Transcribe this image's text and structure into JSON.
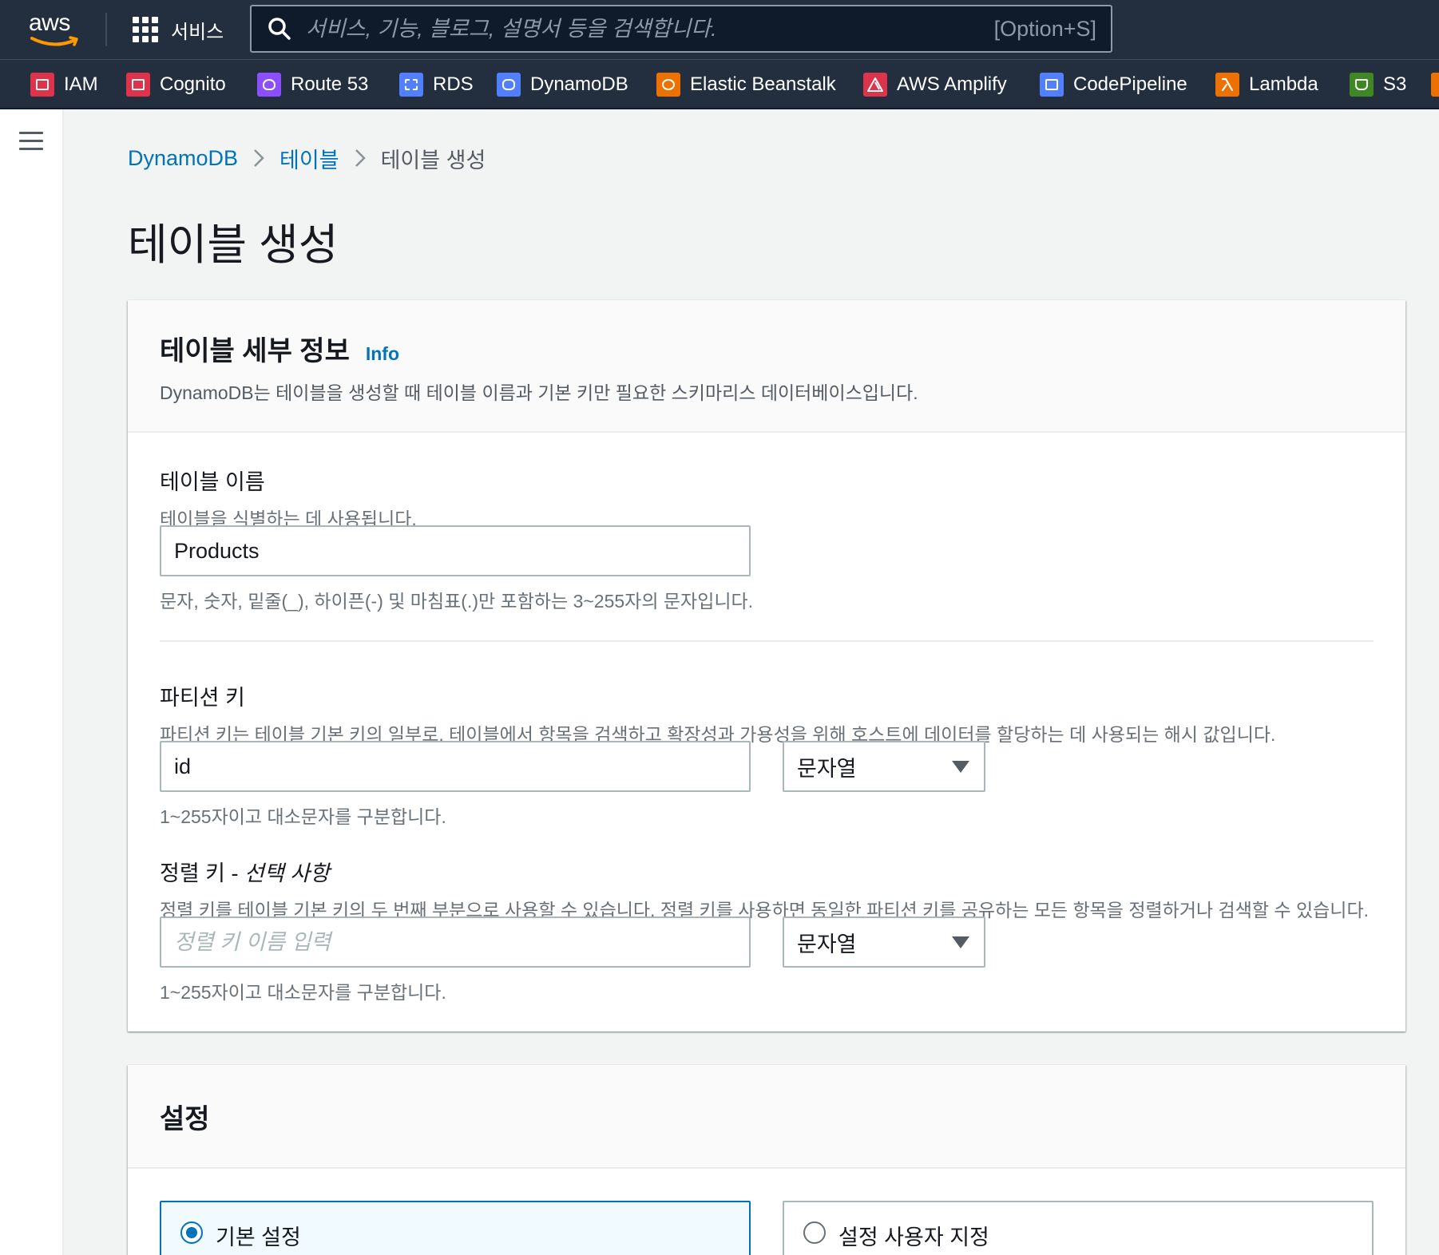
{
  "header": {
    "logo_text": "aws",
    "services_label": "서비스",
    "search_placeholder": "서비스, 기능, 블로그, 설명서 등을 검색합니다.",
    "search_shortcut": "[Option+S]"
  },
  "favorites": [
    {
      "label": "IAM",
      "icon": "iam-icon",
      "color": "#dd344c"
    },
    {
      "label": "Cognito",
      "icon": "cognito-icon",
      "color": "#dd344c"
    },
    {
      "label": "Route 53",
      "icon": "route53-icon",
      "color": "#8c4fff"
    },
    {
      "label": "RDS",
      "icon": "rds-icon",
      "color": "#527fff"
    },
    {
      "label": "DynamoDB",
      "icon": "dynamodb-icon",
      "color": "#527fff"
    },
    {
      "label": "Elastic Beanstalk",
      "icon": "elastic-beanstalk-icon",
      "color": "#ed7100"
    },
    {
      "label": "AWS Amplify",
      "icon": "amplify-icon",
      "color": "#dd344c"
    },
    {
      "label": "CodePipeline",
      "icon": "codepipeline-icon",
      "color": "#527fff"
    },
    {
      "label": "Lambda",
      "icon": "lambda-icon",
      "color": "#ed7100"
    },
    {
      "label": "S3",
      "icon": "s3-icon",
      "color": "#3f8624"
    }
  ],
  "breadcrumb": {
    "items": [
      "DynamoDB",
      "테이블"
    ],
    "current": "테이블 생성"
  },
  "page": {
    "title": "테이블 생성"
  },
  "table_details": {
    "heading": "테이블 세부 정보",
    "info_label": "Info",
    "description": "DynamoDB는 테이블을 생성할 때 테이블 이름과 기본 키만 필요한 스키마리스 데이터베이스입니다.",
    "table_name": {
      "label": "테이블 이름",
      "description": "테이블을 식별하는 데 사용됩니다.",
      "value": "Products",
      "hint": "문자, 숫자, 밑줄(_), 하이픈(-) 및 마침표(.)만 포함하는 3~255자의 문자입니다."
    },
    "partition_key": {
      "label": "파티션 키",
      "description": "파티션 키는 테이블 기본 키의 일부로, 테이블에서 항목을 검색하고 확장성과 가용성을 위해 호스트에 데이터를 할당하는 데 사용되는 해시 값입니다.",
      "value": "id",
      "type": "문자열",
      "hint": "1~255자이고 대소문자를 구분합니다."
    },
    "sort_key": {
      "label": "정렬 키 - ",
      "label_optional": "선택 사항",
      "description": "정렬 키를 테이블 기본 키의 두 번째 부분으로 사용할 수 있습니다. 정렬 키를 사용하면 동일한 파티션 키를 공유하는 모든 항목을 정렬하거나 검색할 수 있습니다.",
      "placeholder": "정렬 키 이름 입력",
      "type": "문자열",
      "hint": "1~255자이고 대소문자를 구분합니다."
    }
  },
  "settings": {
    "heading": "설정",
    "options": [
      {
        "label": "기본 설정",
        "selected": true
      },
      {
        "label": "설정 사용자 지정",
        "selected": false
      }
    ]
  },
  "colors": {
    "header_bg": "#232f3e",
    "link": "#0073bb",
    "page_bg": "#f2f3f3"
  }
}
